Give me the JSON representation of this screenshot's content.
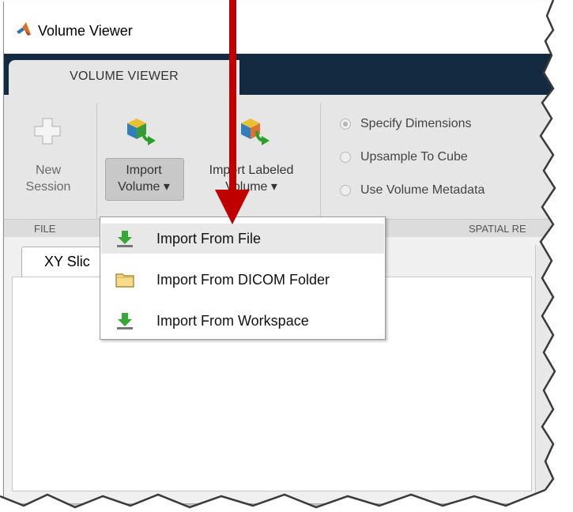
{
  "window": {
    "title": "Volume Viewer"
  },
  "toolstrip": {
    "tab": "VOLUME VIEWER",
    "buttons": {
      "new_session": {
        "line1": "New",
        "line2": "Session"
      },
      "import_volume": {
        "line1": "Import",
        "line2": "Volume ▾"
      },
      "import_labeled": {
        "line1": "Import Labeled",
        "line2": "Volume ▾"
      }
    },
    "sections": {
      "file": "FILE",
      "spatial": "SPATIAL RE"
    },
    "radio_options": [
      {
        "label": "Specify Dimensions",
        "selected": true
      },
      {
        "label": "Upsample To Cube",
        "selected": false
      },
      {
        "label": "Use Volume Metadata",
        "selected": false
      }
    ],
    "partial_letter": "Y"
  },
  "document": {
    "tab_label": "XY Slic"
  },
  "import_menu": {
    "items": [
      {
        "label": "Import From File",
        "icon": "download-arrow-icon"
      },
      {
        "label": "Import From DICOM Folder",
        "icon": "folder-icon"
      },
      {
        "label": "Import From Workspace",
        "icon": "download-arrow-icon"
      }
    ]
  },
  "colors": {
    "tabstrip": "#142a40",
    "ribbon": "#e6e6e6",
    "annotation_arrow": "#c00000"
  }
}
